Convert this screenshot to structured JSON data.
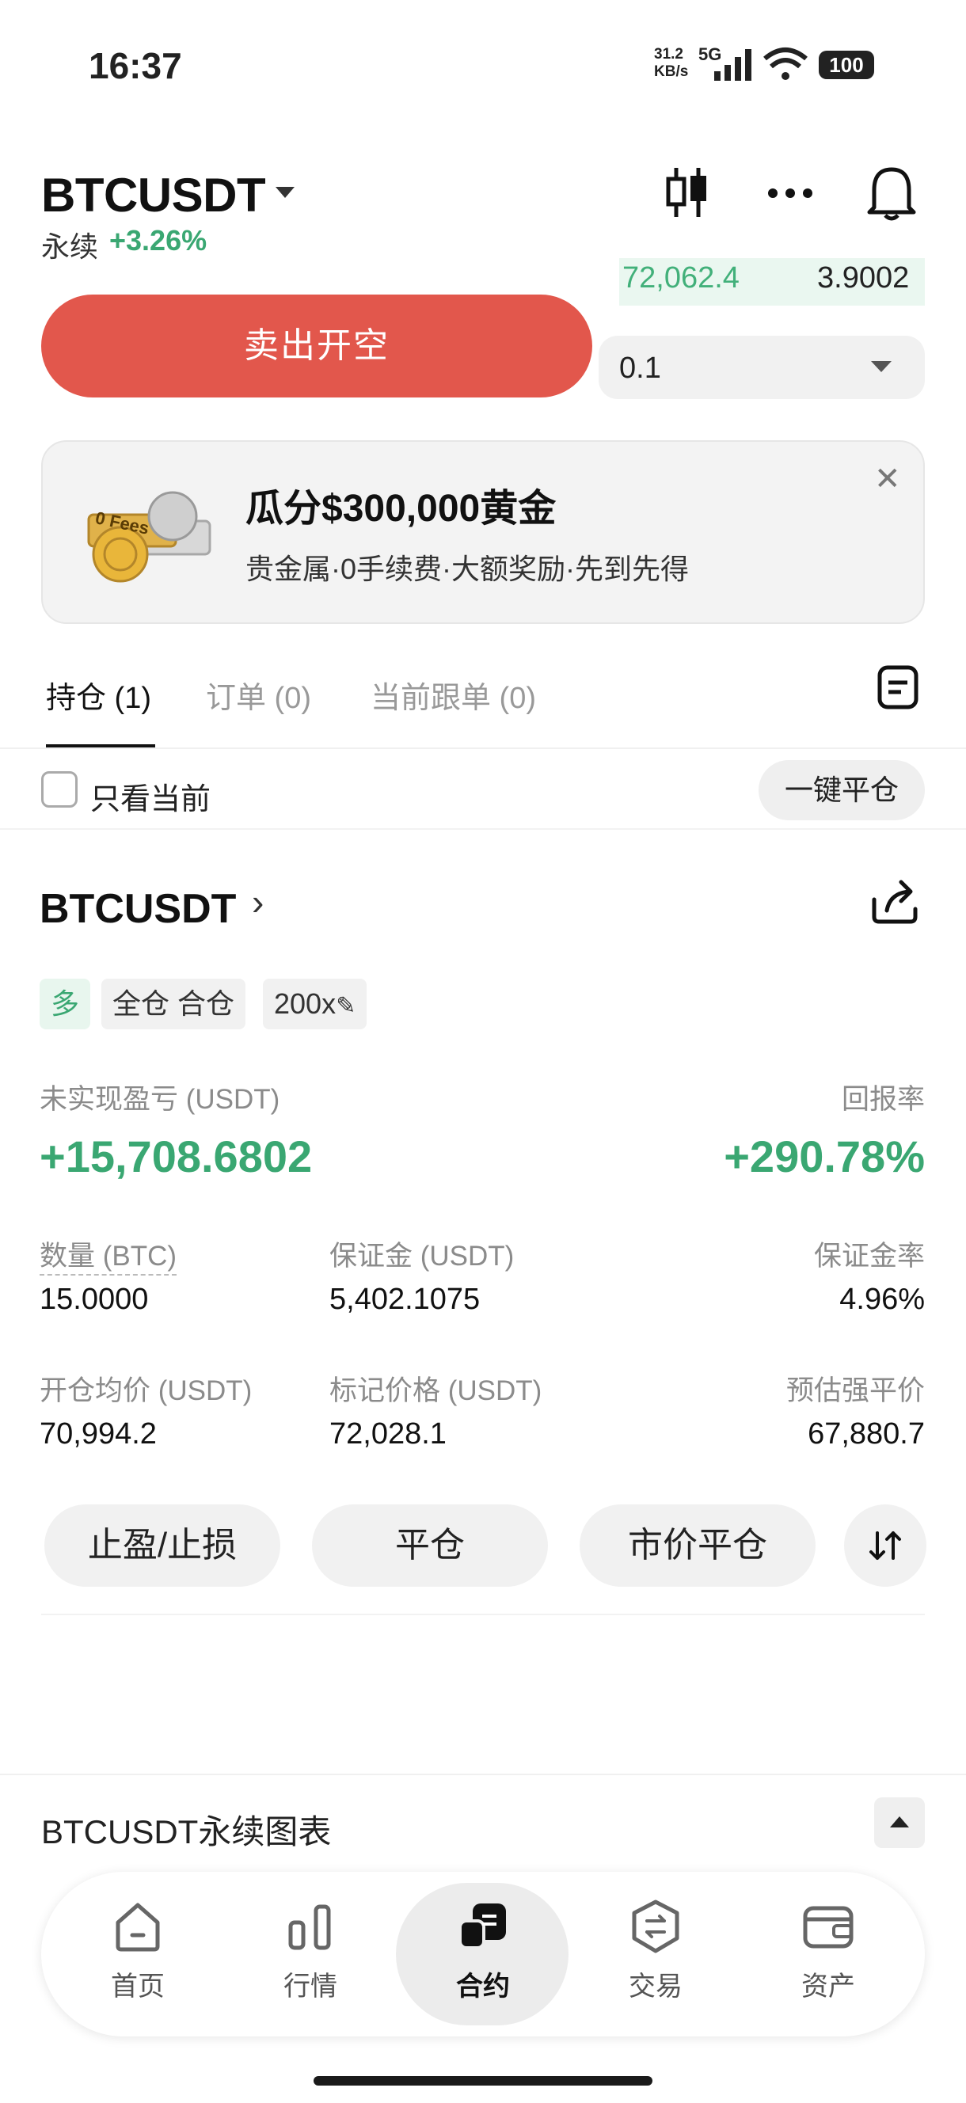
{
  "status_bar": {
    "time": "16:37",
    "net_speed": "31.2 KB/s",
    "net_type": "5G",
    "battery": "100"
  },
  "header": {
    "symbol": "BTCUSDT",
    "contract_type": "永续",
    "change": "+3.26%"
  },
  "orderbook": {
    "price": "72,062.4",
    "size": "3.9002"
  },
  "trade": {
    "sell_label": "卖出开空",
    "quantity": "0.1"
  },
  "promo": {
    "title": "瓜分$300,000黄金",
    "description": "贵金属·0手续费·大额奖励·先到先得",
    "coin_text": "0 Fees"
  },
  "tabs": [
    {
      "label": "持仓 (1)",
      "active": true
    },
    {
      "label": "订单 (0)",
      "active": false
    },
    {
      "label": "当前跟单 (0)",
      "active": false
    }
  ],
  "filter": {
    "only_current": "只看当前",
    "close_all": "一键平仓"
  },
  "position": {
    "symbol": "BTCUSDT",
    "side": "多",
    "margin_mode": "全仓 合仓",
    "leverage": "200x",
    "pnl_label": "未实现盈亏 (USDT)",
    "pnl_value": "+15,708.6802",
    "roe_label": "回报率",
    "roe_value": "+290.78%",
    "qty_label": "数量 (BTC)",
    "qty_value": "15.0000",
    "margin_label": "保证金 (USDT)",
    "margin_value": "5,402.1075",
    "margin_rate_label": "保证金率",
    "margin_rate_value": "4.96%",
    "entry_label": "开仓均价 (USDT)",
    "entry_value": "70,994.2",
    "mark_label": "标记价格 (USDT)",
    "mark_value": "72,028.1",
    "liq_label": "预估强平价",
    "liq_value": "67,880.7",
    "actions": {
      "tp_sl": "止盈/止损",
      "close": "平仓",
      "market_close": "市价平仓"
    }
  },
  "chart_bar": {
    "label": "BTCUSDT永续图表"
  },
  "nav": [
    {
      "label": "首页",
      "icon": "home-icon"
    },
    {
      "label": "行情",
      "icon": "market-icon"
    },
    {
      "label": "合约",
      "icon": "futures-icon",
      "active": true
    },
    {
      "label": "交易",
      "icon": "trade-icon"
    },
    {
      "label": "资产",
      "icon": "wallet-icon"
    }
  ],
  "colors": {
    "green": "#3aa772",
    "red": "#e2574c"
  }
}
